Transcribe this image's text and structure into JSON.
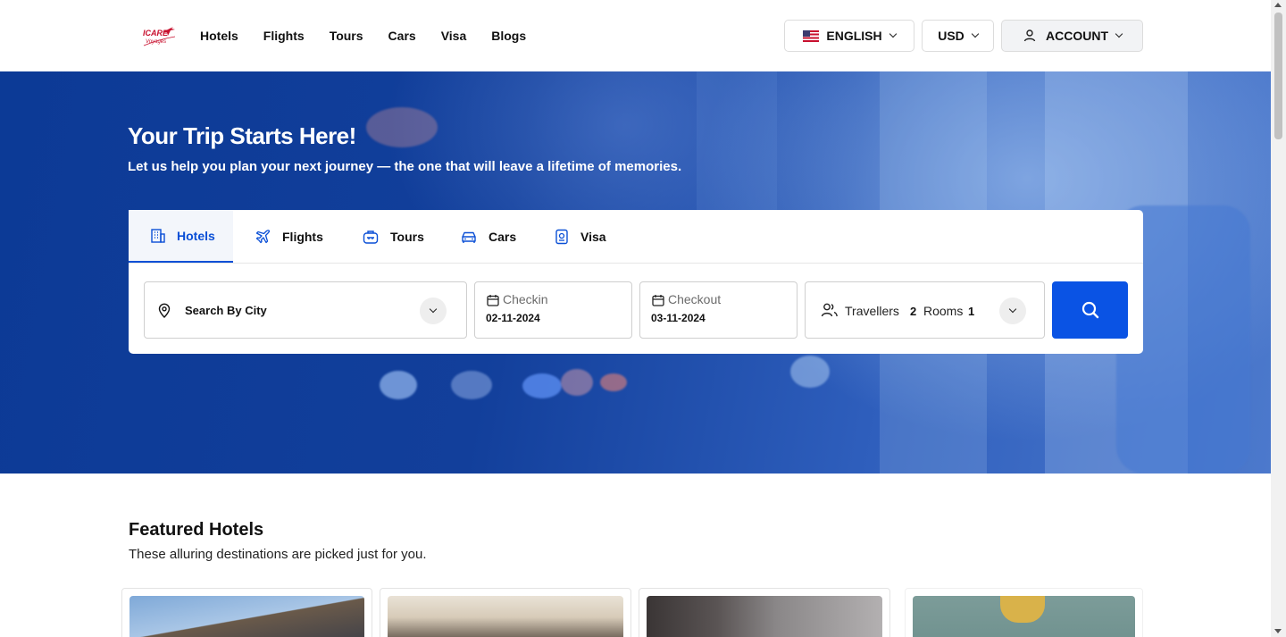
{
  "header": {
    "logo_text": "ICARE",
    "logo_subtext": "Voyages",
    "nav": [
      "Hotels",
      "Flights",
      "Tours",
      "Cars",
      "Visa",
      "Blogs"
    ],
    "language": "ENGLISH",
    "currency": "USD",
    "account": "ACCOUNT"
  },
  "hero": {
    "title": "Your Trip Starts Here!",
    "subtitle": "Let us help you plan your next journey — the one that will leave a lifetime of memories."
  },
  "search": {
    "tabs": [
      {
        "label": "Hotels",
        "icon": "hotel-icon",
        "active": true
      },
      {
        "label": "Flights",
        "icon": "plane-icon",
        "active": false
      },
      {
        "label": "Tours",
        "icon": "bag-icon",
        "active": false
      },
      {
        "label": "Cars",
        "icon": "car-icon",
        "active": false
      },
      {
        "label": "Visa",
        "icon": "passport-icon",
        "active": false
      }
    ],
    "city_placeholder": "Search By City",
    "checkin_label": "Checkin",
    "checkin_value": "02-11-2024",
    "checkout_label": "Checkout",
    "checkout_value": "03-11-2024",
    "travellers_label": "Travellers",
    "travellers_value": "2",
    "rooms_label": "Rooms",
    "rooms_value": "1"
  },
  "featured": {
    "title": "Featured Hotels",
    "subtitle": "These alluring destinations are picked just for you."
  },
  "colors": {
    "accent": "#0a53e4",
    "hero_blue": "#123f9b"
  }
}
